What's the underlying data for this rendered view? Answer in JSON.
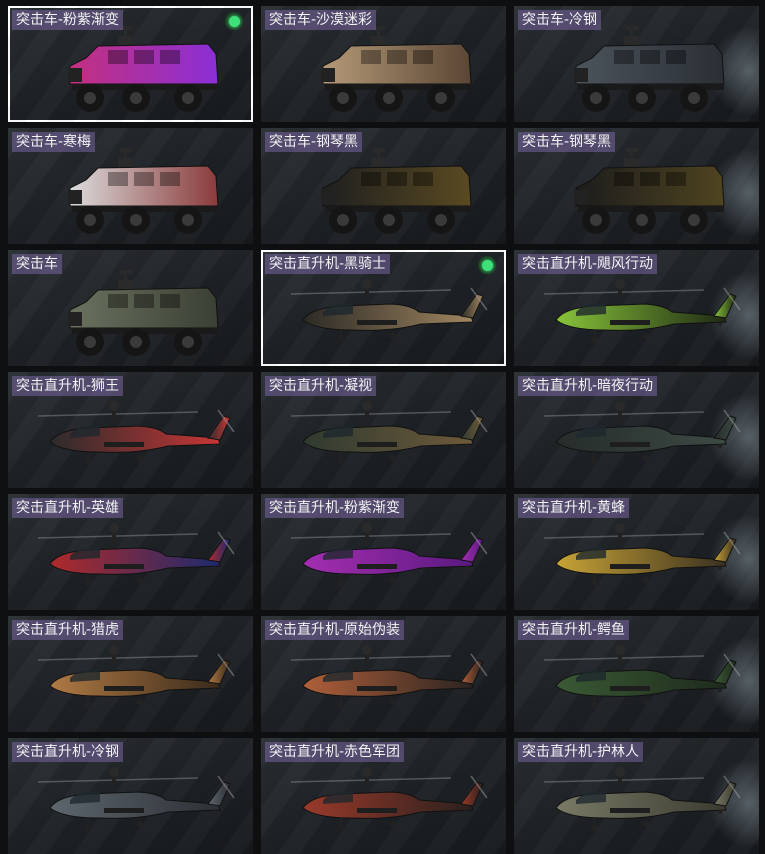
{
  "items": [
    {
      "label": "突击车-粉紫渐变",
      "type": "car",
      "colors": [
        "#c3307f",
        "#8b2fd6"
      ],
      "selected": true,
      "equipped": true
    },
    {
      "label": "突击车-沙漠迷彩",
      "type": "car",
      "colors": [
        "#b59a78",
        "#5a4634"
      ],
      "selected": false,
      "equipped": false
    },
    {
      "label": "突击车-冷钢",
      "type": "car",
      "colors": [
        "#4b535b",
        "#2a2f35"
      ],
      "selected": false,
      "equipped": false
    },
    {
      "label": "突击车-寒梅",
      "type": "car",
      "colors": [
        "#dcdcdc",
        "#8a3a3a"
      ],
      "selected": false,
      "equipped": false
    },
    {
      "label": "突击车-钢琴黑",
      "type": "car",
      "colors": [
        "#1f1f1f",
        "#5a4a22"
      ],
      "selected": false,
      "equipped": false
    },
    {
      "label": "突击车-钢琴黑",
      "type": "car",
      "colors": [
        "#1c1c1c",
        "#4f4420"
      ],
      "selected": false,
      "equipped": false
    },
    {
      "label": "突击车",
      "type": "car",
      "colors": [
        "#6a725f",
        "#3a4034"
      ],
      "selected": false,
      "equipped": false
    },
    {
      "label": "突击直升机-黑骑士",
      "type": "heli",
      "colors": [
        "#2c2a26",
        "#a08660"
      ],
      "selected": true,
      "equipped": true
    },
    {
      "label": "突击直升机-飓风行动",
      "type": "heli",
      "colors": [
        "#88c43a",
        "#1f2a14"
      ],
      "selected": false,
      "equipped": false
    },
    {
      "label": "突击直升机-狮王",
      "type": "heli",
      "colors": [
        "#2b2b2b",
        "#c83636"
      ],
      "selected": false,
      "equipped": false
    },
    {
      "label": "突击直升机-凝视",
      "type": "heli",
      "colors": [
        "#2f3a30",
        "#6e5a3a"
      ],
      "selected": false,
      "equipped": false
    },
    {
      "label": "突击直升机-暗夜行动",
      "type": "heli",
      "colors": [
        "#262c2a",
        "#3c4a44"
      ],
      "selected": false,
      "equipped": false
    },
    {
      "label": "突击直升机-英雄",
      "type": "heli",
      "colors": [
        "#b02a2a",
        "#1d2a6e"
      ],
      "selected": false,
      "equipped": false
    },
    {
      "label": "突击直升机-粉紫渐变",
      "type": "heli",
      "colors": [
        "#a42eb0",
        "#5a1a80"
      ],
      "selected": false,
      "equipped": false
    },
    {
      "label": "突击直升机-黄蜂",
      "type": "heli",
      "colors": [
        "#c8a436",
        "#3a3020"
      ],
      "selected": false,
      "equipped": false
    },
    {
      "label": "突击直升机-猎虎",
      "type": "heli",
      "colors": [
        "#b07a44",
        "#3a2a1a"
      ],
      "selected": false,
      "equipped": false
    },
    {
      "label": "突击直升机-原始伪装",
      "type": "heli",
      "colors": [
        "#b0603a",
        "#2a2320"
      ],
      "selected": false,
      "equipped": false
    },
    {
      "label": "突击直升机-鳄鱼",
      "type": "heli",
      "colors": [
        "#3a5a34",
        "#1e2a1c"
      ],
      "selected": false,
      "equipped": false
    },
    {
      "label": "突击直升机-冷钢",
      "type": "heli",
      "colors": [
        "#5d666e",
        "#2c3035"
      ],
      "selected": false,
      "equipped": false
    },
    {
      "label": "突击直升机-赤色军团",
      "type": "heli",
      "colors": [
        "#9a3a2a",
        "#2a201e"
      ],
      "selected": false,
      "equipped": false
    },
    {
      "label": "突击直升机-护林人",
      "type": "heli",
      "colors": [
        "#7a7a66",
        "#3a3a30"
      ],
      "selected": false,
      "equipped": false
    }
  ]
}
